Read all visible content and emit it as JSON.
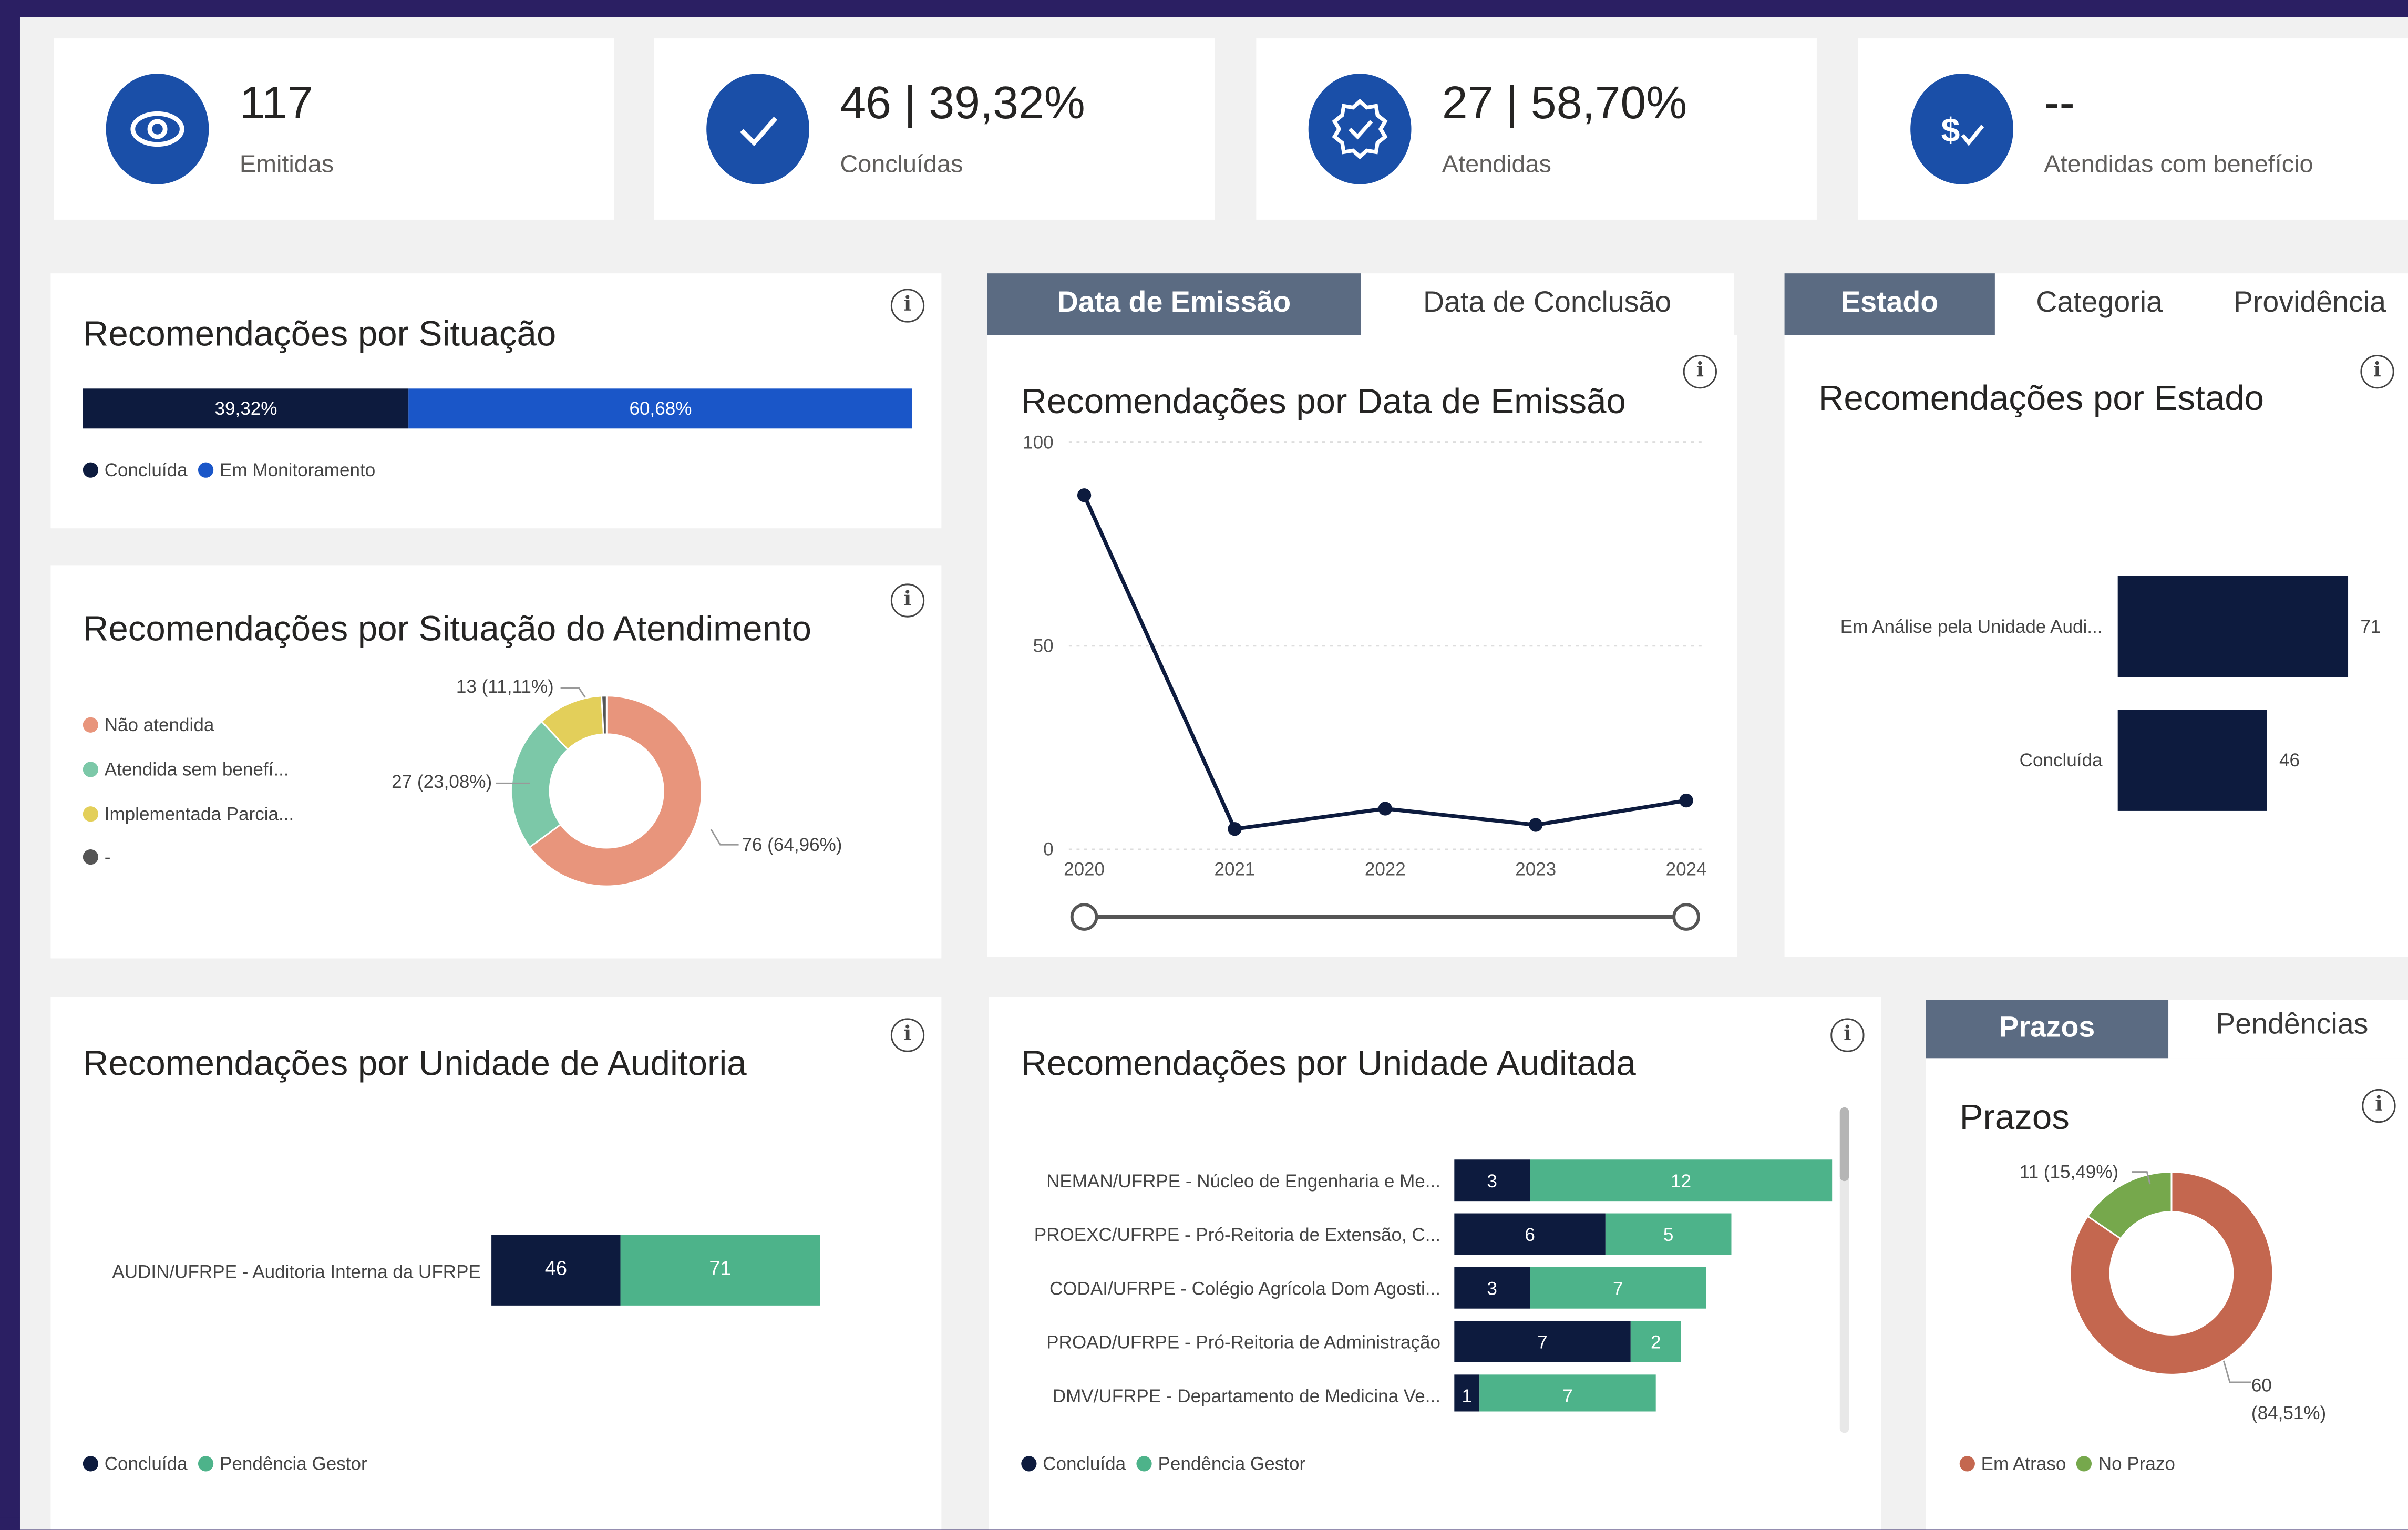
{
  "kpis": [
    {
      "value": "117",
      "label": "Emitidas",
      "icon": "eye-icon"
    },
    {
      "value": "46 | 39,32%",
      "label": "Concluídas",
      "icon": "check-icon"
    },
    {
      "value": "27 | 58,70%",
      "label": "Atendidas",
      "icon": "badge-check-icon"
    },
    {
      "value": "--",
      "label": "Atendidas com benefício",
      "icon": "dollar-check-icon"
    }
  ],
  "situacao": {
    "title": "Recomendações por Situação",
    "segments": [
      {
        "label": "39,32%",
        "name": "Concluída",
        "color": "#0d1b3e",
        "value": 39.32
      },
      {
        "label": "60,68%",
        "name": "Em Monitoramento",
        "color": "#1a56c8",
        "value": 60.68
      }
    ]
  },
  "atendimento": {
    "title": "Recomendações por Situação do Atendimento",
    "legend": [
      {
        "name": "Não atendida",
        "color": "#e8957c"
      },
      {
        "name": "Atendida sem benefí...",
        "color": "#7cc8a8"
      },
      {
        "name": "Implementada Parcia...",
        "color": "#e3cf5a"
      },
      {
        "name": "-",
        "color": "#555555"
      }
    ],
    "callouts": [
      "13 (11,11%)",
      "27 (23,08%)",
      "76 (64,96%)"
    ],
    "values": [
      76,
      27,
      13,
      1
    ]
  },
  "emissao": {
    "tabs": [
      "Data de Emissão",
      "Data de Conclusão"
    ],
    "title": "Recomendações por Data de Emissão",
    "y_ticks": [
      "100",
      "50",
      "0"
    ],
    "x_ticks": [
      "2020",
      "2021",
      "2022",
      "2023",
      "2024"
    ]
  },
  "estado": {
    "tabs": [
      "Estado",
      "Categoria",
      "Providência"
    ],
    "title": "Recomendações por Estado",
    "bars": [
      {
        "label": "Em Análise pela Unidade Audi...",
        "value": "71"
      },
      {
        "label": "Concluída",
        "value": "46"
      }
    ]
  },
  "auditoria": {
    "title": "Recomendações por Unidade de Auditoria",
    "row_label": "AUDIN/UFRPE - Auditoria Interna da UFRPE",
    "concluida": "46",
    "pendencia": "71",
    "legend": [
      "Concluída",
      "Pendência Gestor"
    ]
  },
  "auditada": {
    "title": "Recomendações por Unidade Auditada",
    "rows": [
      {
        "label": "NEMAN/UFRPE - Núcleo de Engenharia e Me...",
        "a": "3",
        "b": "12"
      },
      {
        "label": "PROEXC/UFRPE - Pró-Reitoria de Extensão, C...",
        "a": "6",
        "b": "5"
      },
      {
        "label": "CODAI/UFRPE - Colégio Agrícola Dom Agosti...",
        "a": "3",
        "b": "7"
      },
      {
        "label": "PROAD/UFRPE - Pró-Reitoria de Administração",
        "a": "7",
        "b": "2"
      },
      {
        "label": "DMV/UFRPE - Departamento de Medicina Ve...",
        "a": "1",
        "b": "7"
      }
    ],
    "legend": [
      "Concluída",
      "Pendência Gestor"
    ]
  },
  "prazos": {
    "tabs": [
      "Prazos",
      "Pendências"
    ],
    "title": "Prazos",
    "callouts": [
      "11 (15,49%)",
      "60",
      "(84,51%)"
    ],
    "legend": [
      {
        "name": "Em Atraso",
        "color": "#c4674f"
      },
      {
        "name": "No Prazo",
        "color": "#76a84c"
      }
    ],
    "values": [
      60,
      11
    ]
  },
  "colors": {
    "navy": "#0d1b3e",
    "green": "#4db38a",
    "blue": "#1a56c8",
    "accent": "#1a4fa8"
  },
  "chart_data": [
    {
      "type": "line",
      "title": "Recomendações por Data de Emissão",
      "x": [
        "2020",
        "2021",
        "2022",
        "2023",
        "2024"
      ],
      "series": [
        {
          "values": [
            87,
            5,
            10,
            6,
            12
          ]
        }
      ],
      "ylim": [
        0,
        100
      ]
    },
    {
      "type": "bar",
      "title": "Recomendações por Estado",
      "categories": [
        "Em Análise pela Unidade Audi...",
        "Concluída"
      ],
      "values": [
        71,
        46
      ]
    },
    {
      "type": "bar",
      "title": "Recomendações por Unidade Auditada",
      "categories": [
        "NEMAN/UFRPE - Núcleo de Engenharia e Me...",
        "PROEXC/UFRPE - Pró-Reitoria de Extensão, C...",
        "CODAI/UFRPE - Colégio Agrícola Dom Agosti...",
        "PROAD/UFRPE - Pró-Reitoria de Administração",
        "DMV/UFRPE - Departamento de Medicina Ve..."
      ],
      "series": [
        {
          "name": "Concluída",
          "values": [
            3,
            6,
            3,
            7,
            1
          ]
        },
        {
          "name": "Pendência Gestor",
          "values": [
            12,
            5,
            7,
            2,
            7
          ]
        }
      ]
    },
    {
      "type": "pie",
      "title": "Prazos",
      "categories": [
        "Em Atraso",
        "No Prazo"
      ],
      "values": [
        60,
        11
      ]
    }
  ]
}
